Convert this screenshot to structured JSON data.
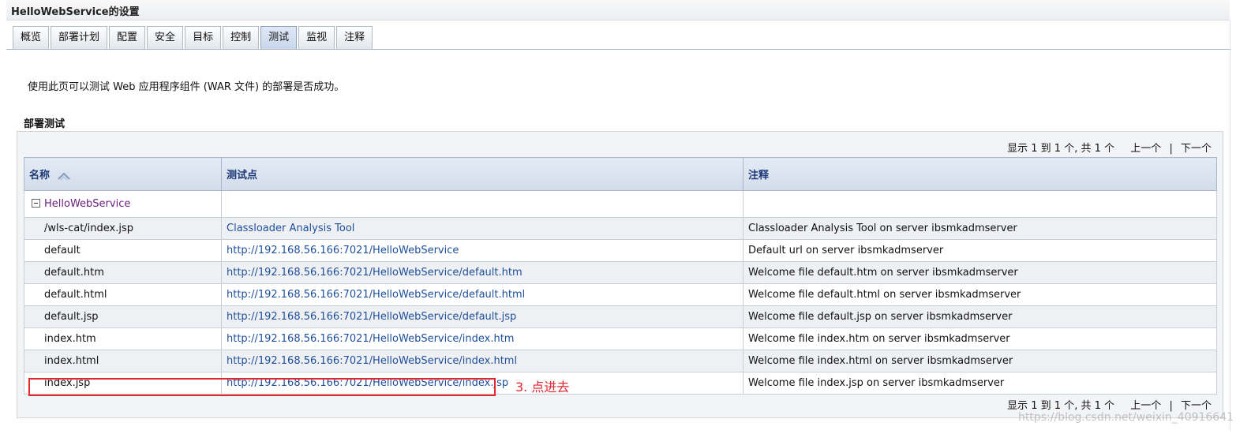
{
  "window": {
    "title": "HelloWebService的设置"
  },
  "tabs": [
    {
      "label": "概览",
      "active": false
    },
    {
      "label": "部署计划",
      "active": false
    },
    {
      "label": "配置",
      "active": false
    },
    {
      "label": "安全",
      "active": false
    },
    {
      "label": "目标",
      "active": false
    },
    {
      "label": "控制",
      "active": false
    },
    {
      "label": "测试",
      "active": true
    },
    {
      "label": "监视",
      "active": false
    },
    {
      "label": "注释",
      "active": false
    }
  ],
  "intro": "使用此页可以测试 Web 应用程序组件 (WAR 文件) 的部署是否成功。",
  "section_title": "部署测试",
  "pager": {
    "summary": "显示 1 到 1 个, 共 1 个",
    "prev": "上一个",
    "separator": "|",
    "next": "下一个"
  },
  "table": {
    "headers": {
      "name": "名称",
      "test_point": "测试点",
      "comment": "注释"
    },
    "sort_icon": "sort-ascending-icon",
    "group": {
      "name": "HelloWebService"
    },
    "rows": [
      {
        "name": "/wls-cat/index.jsp",
        "test_point": "Classloader Analysis Tool",
        "comment": "Classloader Analysis Tool on server ibsmkadmserver"
      },
      {
        "name": "default",
        "test_point": "http://192.168.56.166:7021/HelloWebService",
        "comment": "Default url on server ibsmkadmserver"
      },
      {
        "name": "default.htm",
        "test_point": "http://192.168.56.166:7021/HelloWebService/default.htm",
        "comment": "Welcome file default.htm on server ibsmkadmserver"
      },
      {
        "name": "default.html",
        "test_point": "http://192.168.56.166:7021/HelloWebService/default.html",
        "comment": "Welcome file default.html on server ibsmkadmserver"
      },
      {
        "name": "default.jsp",
        "test_point": "http://192.168.56.166:7021/HelloWebService/default.jsp",
        "comment": "Welcome file default.jsp on server ibsmkadmserver"
      },
      {
        "name": "index.htm",
        "test_point": "http://192.168.56.166:7021/HelloWebService/index.htm",
        "comment": "Welcome file index.htm on server ibsmkadmserver"
      },
      {
        "name": "index.html",
        "test_point": "http://192.168.56.166:7021/HelloWebService/index.html",
        "comment": "Welcome file index.html on server ibsmkadmserver"
      },
      {
        "name": "index.jsp",
        "test_point": "http://192.168.56.166:7021/HelloWebService/index.jsp",
        "comment": "Welcome file index.jsp on server ibsmkadmserver"
      }
    ]
  },
  "annotation": {
    "text": "3. 点进去",
    "color": "#e0262f"
  },
  "watermark": "https://blog.csdn.net/weixin_40916641",
  "colors": {
    "link": "#1e4f9c",
    "group_link": "#6b1f7e",
    "header_text": "#1f3a78"
  }
}
